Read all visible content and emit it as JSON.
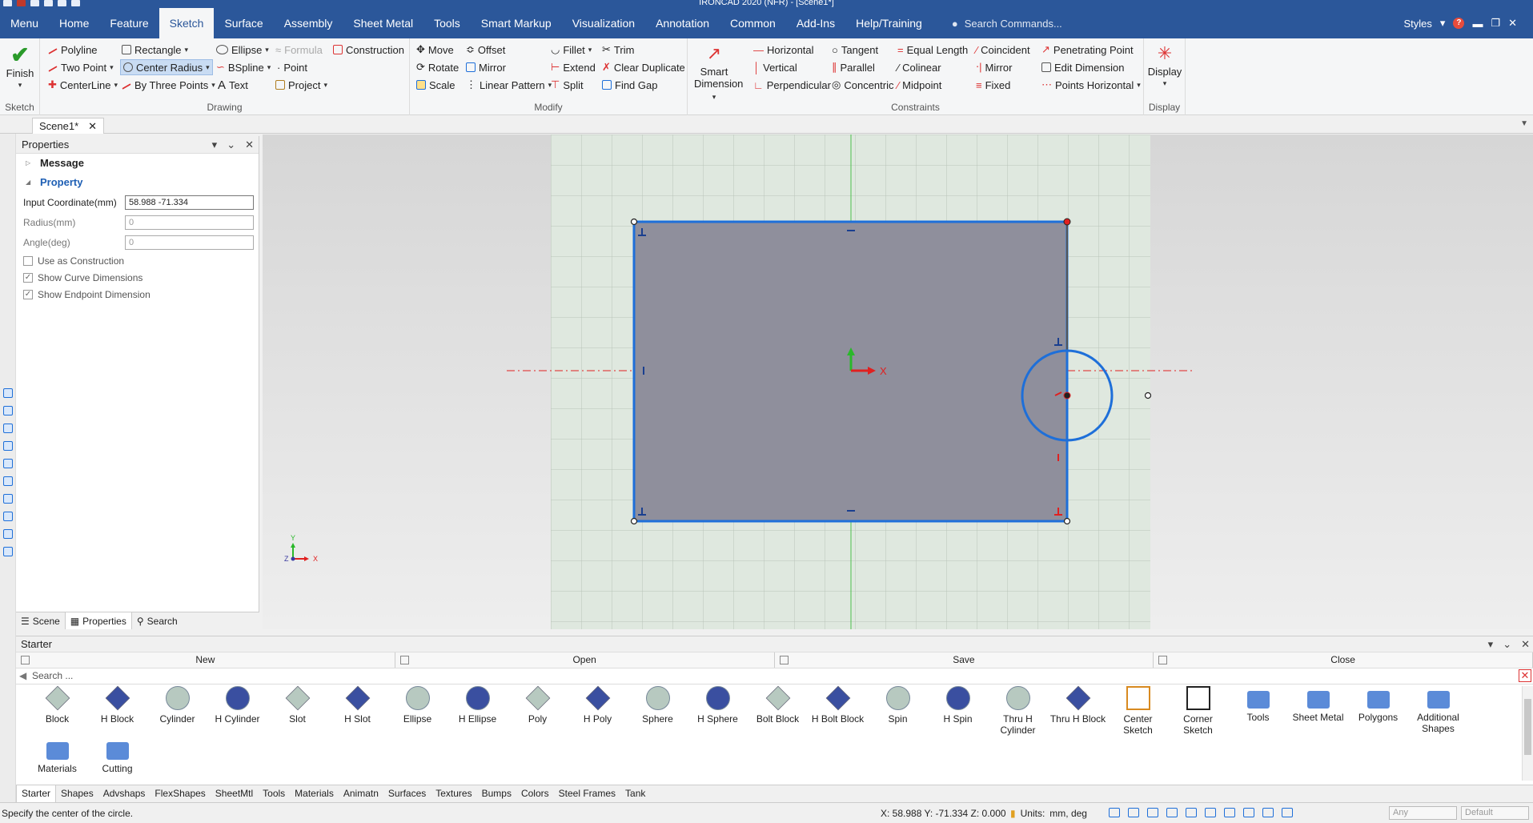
{
  "window": {
    "title": "IRONCAD 2020 (NFR) - [Scene1*]"
  },
  "tabs": {
    "menu": "Menu",
    "home": "Home",
    "feature": "Feature",
    "sketch": "Sketch",
    "surface": "Surface",
    "assembly": "Assembly",
    "sheet_metal": "Sheet Metal",
    "tools": "Tools",
    "smart_markup": "Smart Markup",
    "visualization": "Visualization",
    "annotation": "Annotation",
    "common": "Common",
    "addins": "Add-Ins",
    "help": "Help/Training",
    "search_placeholder": "Search Commands...",
    "styles": "Styles"
  },
  "ribbon": {
    "sketch_group": {
      "name": "Sketch",
      "finish": "Finish"
    },
    "drawing_group": {
      "name": "Drawing",
      "polyline": "Polyline",
      "two_point": "Two Point",
      "centerline": "CenterLine",
      "rectangle": "Rectangle",
      "center_radius": "Center Radius",
      "by_three_points": "By Three Points",
      "ellipse": "Ellipse",
      "bspline": "BSpline",
      "text": "Text",
      "formula": "Formula",
      "point": "Point",
      "project": "Project",
      "construction": "Construction"
    },
    "modify_group": {
      "name": "Modify",
      "move": "Move",
      "rotate": "Rotate",
      "scale": "Scale",
      "offset": "Offset",
      "mirror": "Mirror",
      "linear_pattern": "Linear Pattern",
      "fillet": "Fillet",
      "extend": "Extend",
      "split": "Split",
      "trim": "Trim",
      "clear_duplicate": "Clear Duplicate",
      "find_gap": "Find Gap"
    },
    "constraints_group": {
      "name": "Constraints",
      "smart_dimension_1": "Smart",
      "smart_dimension_2": "Dimension",
      "horizontal": "Horizontal",
      "vertical": "Vertical",
      "perpendicular": "Perpendicular",
      "tangent": "Tangent",
      "parallel": "Parallel",
      "concentric": "Concentric",
      "equal_length": "Equal Length",
      "colinear": "Colinear",
      "midpoint": "Midpoint",
      "coincident": "Coincident",
      "mirror": "Mirror",
      "fixed": "Fixed",
      "penetrating_point": "Penetrating Point",
      "edit_dimension": "Edit Dimension",
      "points_horizontal": "Points Horizontal"
    },
    "display_group": {
      "name": "Display",
      "display": "Display"
    }
  },
  "document_tab": {
    "name": "Scene1*"
  },
  "properties": {
    "title": "Properties",
    "message_section": "Message",
    "property_section": "Property",
    "input_coordinate_label": "Input Coordinate(mm)",
    "input_coordinate_value": "58.988 -71.334",
    "radius_label": "Radius(mm)",
    "radius_value": "0",
    "angle_label": "Angle(deg)",
    "angle_value": "0",
    "use_as_construction": "Use as Construction",
    "show_curve_dimensions": "Show Curve Dimensions",
    "show_endpoint_dimension": "Show Endpoint Dimension",
    "tab_scene": "Scene",
    "tab_properties": "Properties",
    "tab_search": "Search"
  },
  "viewport": {
    "axis_x": "X",
    "triad_x": "X",
    "triad_y": "Y",
    "triad_z": "Z"
  },
  "starter": {
    "title": "Starter",
    "new": "New",
    "open": "Open",
    "save": "Save",
    "close": "Close",
    "search_placeholder": "Search ...",
    "items": [
      {
        "label": "Block",
        "icon": "block-icon"
      },
      {
        "label": "H Block",
        "icon": "h-block-icon"
      },
      {
        "label": "Cylinder",
        "icon": "cylinder-icon"
      },
      {
        "label": "H Cylinder",
        "icon": "h-cylinder-icon"
      },
      {
        "label": "Slot",
        "icon": "slot-icon"
      },
      {
        "label": "H Slot",
        "icon": "h-slot-icon"
      },
      {
        "label": "Ellipse",
        "icon": "ellipse-icon"
      },
      {
        "label": "H Ellipse",
        "icon": "h-ellipse-icon"
      },
      {
        "label": "Poly",
        "icon": "poly-icon"
      },
      {
        "label": "H Poly",
        "icon": "h-poly-icon"
      },
      {
        "label": "Sphere",
        "icon": "sphere-icon"
      },
      {
        "label": "H Sphere",
        "icon": "h-sphere-icon"
      },
      {
        "label": "Bolt Block",
        "icon": "bolt-block-icon"
      },
      {
        "label": "H Bolt Block",
        "icon": "h-bolt-block-icon"
      },
      {
        "label": "Spin",
        "icon": "spin-icon"
      },
      {
        "label": "H Spin",
        "icon": "h-spin-icon"
      },
      {
        "label": "Thru H Cylinder",
        "icon": "thru-h-cylinder-icon"
      },
      {
        "label": "Thru H Block",
        "icon": "thru-h-block-icon"
      },
      {
        "label": "Center Sketch",
        "icon": "center-sketch-icon"
      },
      {
        "label": "Corner Sketch",
        "icon": "corner-sketch-icon"
      },
      {
        "label": "Tools",
        "icon": "folder-icon"
      },
      {
        "label": "Sheet Metal",
        "icon": "folder-icon"
      },
      {
        "label": "Polygons",
        "icon": "folder-icon"
      },
      {
        "label": "Additional Shapes",
        "icon": "folder-icon"
      },
      {
        "label": "Materials",
        "icon": "folder-icon"
      },
      {
        "label": "Cutting",
        "icon": "folder-icon"
      }
    ],
    "tabs": [
      "Starter",
      "Shapes",
      "Advshaps",
      "FlexShapes",
      "SheetMtl",
      "Tools",
      "Materials",
      "Animatn",
      "Surfaces",
      "Textures",
      "Bumps",
      "Colors",
      "Steel Frames",
      "Tank"
    ]
  },
  "status": {
    "message": "Specify the center of the circle.",
    "coordinates": "X: 58.988 Y: -71.334 Z: 0.000",
    "units_label": "Units:",
    "units_value": "mm, deg",
    "filter_any": "Any",
    "filter_default": "Default"
  },
  "colors": {
    "ribbon_blue": "#2b579a",
    "sketch_blue": "#1e6fd9",
    "profile_fill": "#8f8f9c",
    "axis_red": "#e02020"
  }
}
